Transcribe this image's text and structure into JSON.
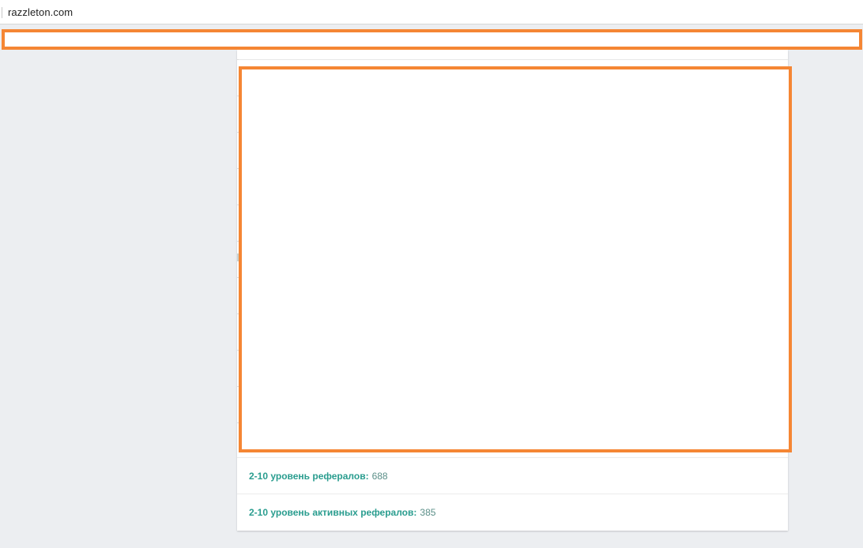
{
  "browser": {
    "address": "razzleton.com"
  },
  "stats": [
    {
      "label": "2-10 уровень рефералов:",
      "value": "688"
    },
    {
      "label": "2-10 уровень активных рефералов:",
      "value": "385"
    }
  ],
  "colors": {
    "accent": "#2a9d8f",
    "redaction": "#f58634",
    "background": "#eceef1"
  }
}
